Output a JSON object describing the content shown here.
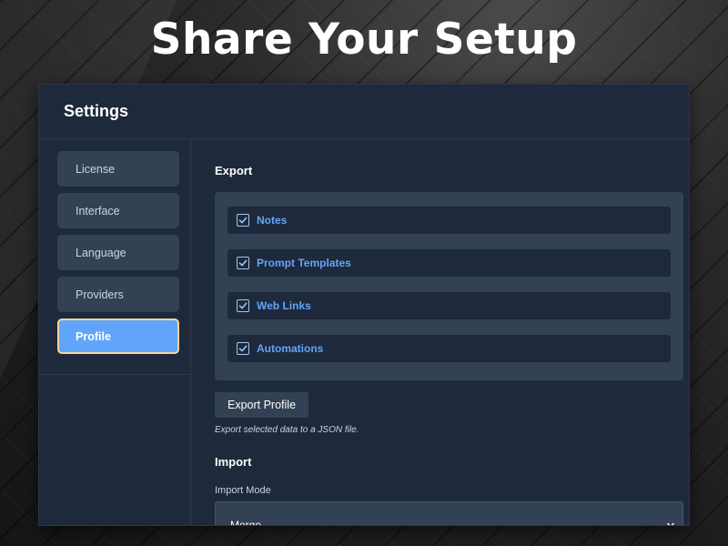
{
  "headline": "Share Your Setup",
  "window": {
    "title": "Settings"
  },
  "sidebar": {
    "items": [
      {
        "label": "License",
        "active": false
      },
      {
        "label": "Interface",
        "active": false
      },
      {
        "label": "Language",
        "active": false
      },
      {
        "label": "Providers",
        "active": false
      },
      {
        "label": "Profile",
        "active": true
      }
    ]
  },
  "export": {
    "title": "Export",
    "items": [
      {
        "label": "Notes",
        "checked": true,
        "icon": "checkbox-checked-icon"
      },
      {
        "label": "Prompt Templates",
        "checked": true,
        "icon": "checkbox-checked-icon"
      },
      {
        "label": "Web Links",
        "checked": true,
        "icon": "checkbox-checked-icon"
      },
      {
        "label": "Automations",
        "checked": true,
        "icon": "checkbox-checked-icon"
      }
    ],
    "button_label": "Export Profile",
    "hint": "Export selected data to a JSON file."
  },
  "import": {
    "title": "Import",
    "mode_label": "Import Mode",
    "mode_value": "Merge",
    "mode_icon": "chevron-down-icon"
  },
  "colors": {
    "accent": "#60a5fa",
    "active_border": "#f5d49b",
    "panel": "#1e293b",
    "card": "#334155"
  }
}
